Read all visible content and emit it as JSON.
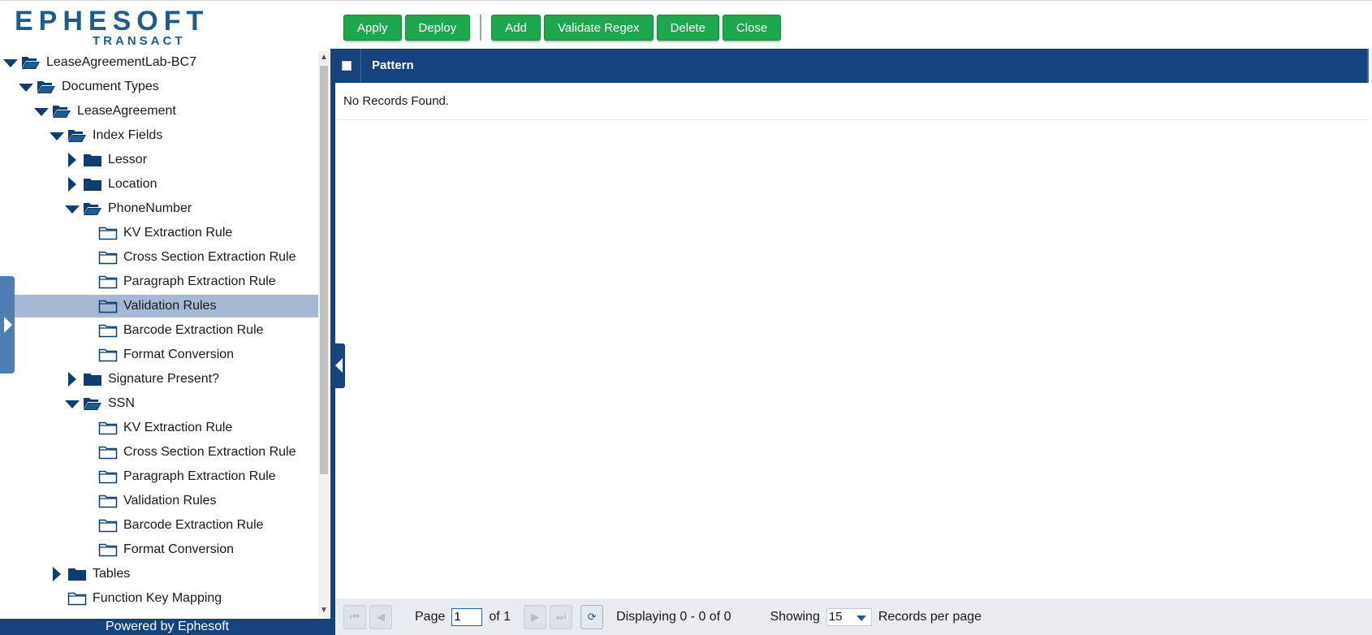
{
  "logo": {
    "word": "EPHESOFT",
    "sub": "TRANSACT"
  },
  "toolbar": {
    "apply": "Apply",
    "deploy": "Deploy",
    "add": "Add",
    "validate_regex": "Validate Regex",
    "delete": "Delete",
    "close": "Close"
  },
  "tree": {
    "items": [
      {
        "label": "LeaseAgreementLab-BC7",
        "level": 0,
        "state": "open",
        "icon": "folder-open-icon"
      },
      {
        "label": "Document Types",
        "level": 1,
        "state": "open",
        "icon": "folder-open-icon"
      },
      {
        "label": "LeaseAgreement",
        "level": 2,
        "state": "open",
        "icon": "folder-open-icon"
      },
      {
        "label": "Index Fields",
        "level": 3,
        "state": "open",
        "icon": "folder-open-icon"
      },
      {
        "label": "Lessor",
        "level": 4,
        "state": "closed",
        "icon": "folder-filled-icon"
      },
      {
        "label": "Location",
        "level": 4,
        "state": "closed",
        "icon": "folder-filled-icon"
      },
      {
        "label": "PhoneNumber",
        "level": 4,
        "state": "open",
        "icon": "folder-open-icon"
      },
      {
        "label": "KV Extraction Rule",
        "level": 5,
        "state": "leaf",
        "icon": "folder-outline-icon"
      },
      {
        "label": "Cross Section Extraction Rule",
        "level": 5,
        "state": "leaf",
        "icon": "folder-outline-icon"
      },
      {
        "label": "Paragraph Extraction Rule",
        "level": 5,
        "state": "leaf",
        "icon": "folder-outline-icon"
      },
      {
        "label": "Validation Rules",
        "level": 5,
        "state": "leaf",
        "icon": "folder-outline-icon",
        "selected": true
      },
      {
        "label": "Barcode Extraction Rule",
        "level": 5,
        "state": "leaf",
        "icon": "folder-outline-icon"
      },
      {
        "label": "Format Conversion",
        "level": 5,
        "state": "leaf",
        "icon": "folder-outline-icon"
      },
      {
        "label": "Signature Present?",
        "level": 4,
        "state": "closed",
        "icon": "folder-filled-icon"
      },
      {
        "label": "SSN",
        "level": 4,
        "state": "open",
        "icon": "folder-open-icon"
      },
      {
        "label": "KV Extraction Rule",
        "level": 5,
        "state": "leaf",
        "icon": "folder-outline-icon"
      },
      {
        "label": "Cross Section Extraction Rule",
        "level": 5,
        "state": "leaf",
        "icon": "folder-outline-icon"
      },
      {
        "label": "Paragraph Extraction Rule",
        "level": 5,
        "state": "leaf",
        "icon": "folder-outline-icon"
      },
      {
        "label": "Validation Rules",
        "level": 5,
        "state": "leaf",
        "icon": "folder-outline-icon"
      },
      {
        "label": "Barcode Extraction Rule",
        "level": 5,
        "state": "leaf",
        "icon": "folder-outline-icon"
      },
      {
        "label": "Format Conversion",
        "level": 5,
        "state": "leaf",
        "icon": "folder-outline-icon"
      },
      {
        "label": "Tables",
        "level": 3,
        "state": "closed",
        "icon": "folder-filled-icon"
      },
      {
        "label": "Function Key Mapping",
        "level": 3,
        "state": "leaf",
        "icon": "folder-outline-icon"
      }
    ]
  },
  "footer": {
    "text": "Powered by Ephesoft"
  },
  "grid": {
    "columns": [
      "Pattern"
    ],
    "empty_text": "No Records Found."
  },
  "pager": {
    "page_label": "Page",
    "page_value": "1",
    "of_label": "of 1",
    "displaying": "Displaying 0 - 0 of 0",
    "showing_label": "Showing",
    "per_page_value": "15",
    "records_label": "Records per page"
  },
  "colors": {
    "primary": "#15437d",
    "button_green": "#1ea84e",
    "selected_row": "#a6b8d3",
    "logo_blue": "#1d5c8c"
  }
}
